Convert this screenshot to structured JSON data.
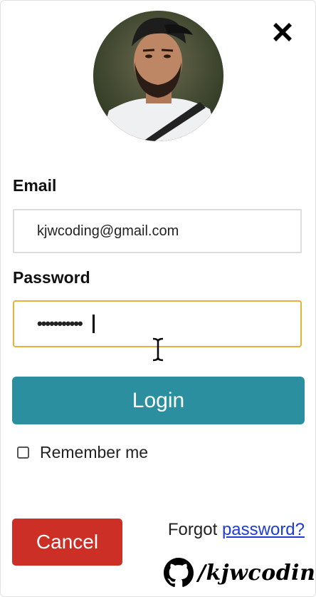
{
  "login_form": {
    "email_label": "Email",
    "email_value": "kjwcoding@gmail.com",
    "password_label": "Password",
    "password_value": "•••••••••••",
    "login_button": "Login",
    "remember_label": "Remember me",
    "remember_checked": false,
    "cancel_button": "Cancel",
    "forgot_text": "Forgot",
    "forgot_link": "password?"
  },
  "icons": {
    "close": "close-icon",
    "avatar": "profile-avatar",
    "cursor": "text-cursor-icon",
    "github": "github-icon"
  },
  "watermark": {
    "text": "/kjwcoding"
  },
  "colors": {
    "login_button": "#2b8fa0",
    "cancel_button": "#cc2f26",
    "focus_border": "#e2b33c",
    "link": "#1f3bd6"
  }
}
